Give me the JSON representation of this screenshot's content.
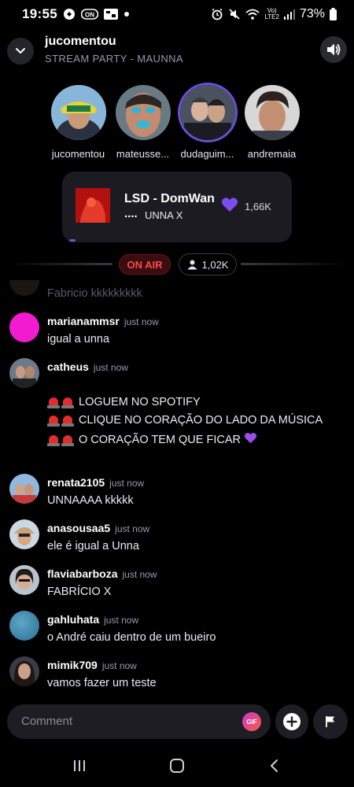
{
  "status_bar": {
    "time": "19:55",
    "battery": "73%",
    "network_label_top": "Vo)",
    "network_label_bottom": "LTE2"
  },
  "header": {
    "title": "jucomentou",
    "subtitle": "STREAM PARTY - MAUNNA"
  },
  "participants": [
    {
      "name": "jucomentou",
      "icon": "avatar-yellow-cap"
    },
    {
      "name": "mateusse...",
      "icon": "avatar-blue-lips"
    },
    {
      "name": "dudaguim...",
      "icon": "avatar-couple"
    },
    {
      "name": "andremaia",
      "icon": "avatar-man-smiling"
    }
  ],
  "now_playing": {
    "song": "LSD - DomWan",
    "artist_prefix": "....",
    "artist": "UNNA X",
    "likes": "1,66K"
  },
  "live": {
    "on_air": "ON AIR",
    "viewers": "1,02K"
  },
  "chat": {
    "faded_text": "Fabricio kkkkkkkkk",
    "messages": [
      {
        "user": "marianammsr",
        "time": "just now",
        "text": "igual a unna"
      },
      {
        "user": "catheus",
        "time": "just now",
        "lines": [
          "LOGUEM NO SPOTIFY",
          "CLIQUE NO CORAÇÃO DO LADO DA MÚSICA",
          "O CORAÇÃO TEM QUE FICAR"
        ]
      },
      {
        "user": "renata2105",
        "time": "just now",
        "text": "UNNAAAA kkkkk"
      },
      {
        "user": "anasousaa5",
        "time": "just now",
        "text": "ele é igual a Unna"
      },
      {
        "user": "flaviabarboza",
        "time": "just now",
        "text": "FABRÍCIO X"
      },
      {
        "user": "gahluhata",
        "time": "just now",
        "text": "o André caiu dentro de um bueiro"
      },
      {
        "user": "mimik709",
        "time": "just now",
        "text": "vamos fazer um teste"
      }
    ]
  },
  "composer": {
    "placeholder": "Comment",
    "gif_label": "GIF"
  },
  "colors": {
    "accent_purple": "#7b4cf0",
    "on_air_red": "#ff4a4a",
    "background": "#000000"
  }
}
